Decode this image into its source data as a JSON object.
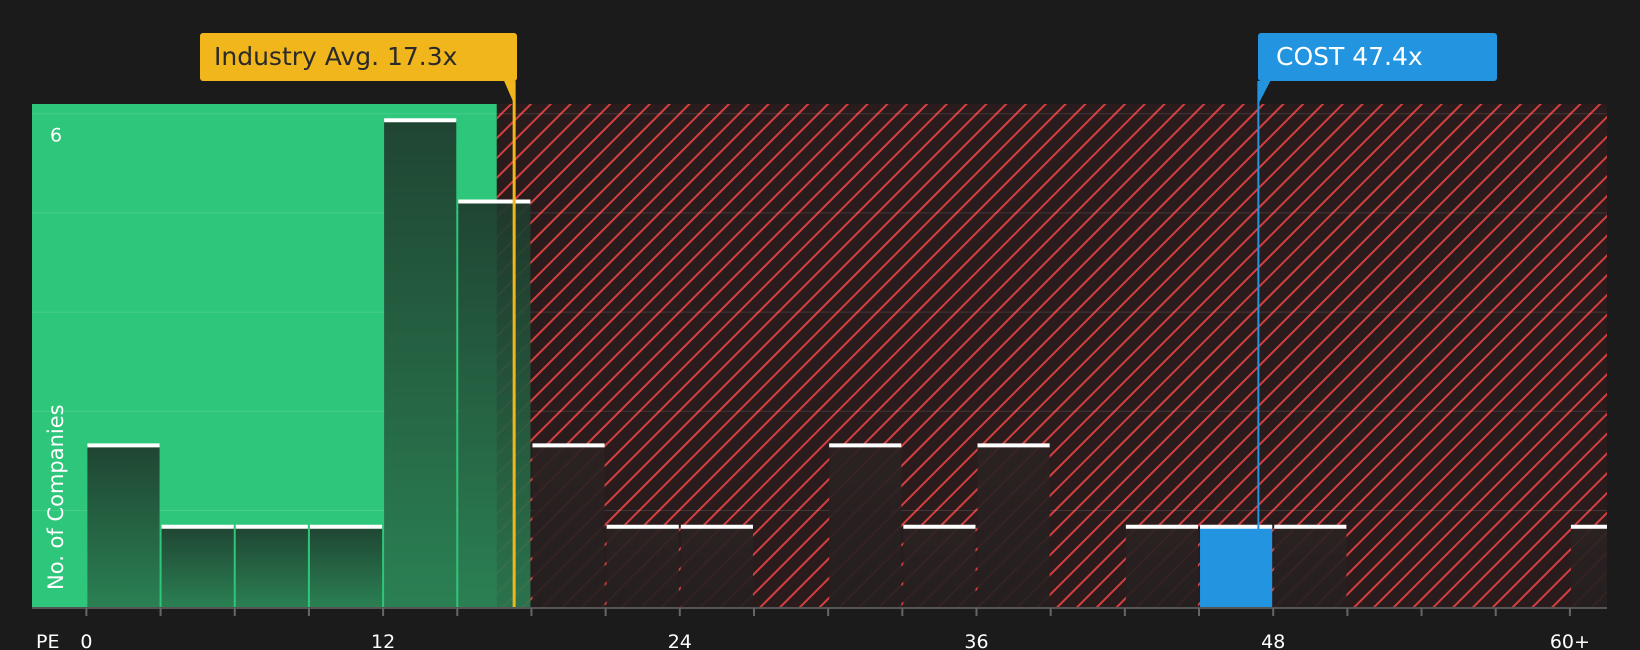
{
  "chart_data": {
    "type": "bar",
    "ylabel": "No. of Companies",
    "xaxis_label": "PE",
    "x_ticks": [
      {
        "value": 0,
        "label": "0"
      },
      {
        "value": 12,
        "label": "12"
      },
      {
        "value": 24,
        "label": "24"
      },
      {
        "value": 36,
        "label": "36"
      },
      {
        "value": 48,
        "label": "48"
      },
      {
        "value": 60,
        "label": "60+"
      }
    ],
    "y_ticks": [
      {
        "value": 6,
        "label": "6"
      }
    ],
    "ylim": [
      0,
      6.2
    ],
    "xlim": [
      -2.2,
      61.5
    ],
    "bin_width": 3,
    "bins": [
      {
        "x": 0,
        "count": 2
      },
      {
        "x": 3,
        "count": 1
      },
      {
        "x": 6,
        "count": 1
      },
      {
        "x": 9,
        "count": 1
      },
      {
        "x": 12,
        "count": 6
      },
      {
        "x": 15,
        "count": 5
      },
      {
        "x": 18,
        "count": 2
      },
      {
        "x": 21,
        "count": 1
      },
      {
        "x": 24,
        "count": 1
      },
      {
        "x": 27,
        "count": 0
      },
      {
        "x": 30,
        "count": 2
      },
      {
        "x": 33,
        "count": 1
      },
      {
        "x": 36,
        "count": 2
      },
      {
        "x": 39,
        "count": 0
      },
      {
        "x": 42,
        "count": 1
      },
      {
        "x": 45,
        "count": 1,
        "highlight": true
      },
      {
        "x": 48,
        "count": 1
      },
      {
        "x": 51,
        "count": 0
      },
      {
        "x": 54,
        "count": 0
      },
      {
        "x": 57,
        "count": 0
      },
      {
        "x": 60,
        "count": 1
      }
    ],
    "industry_avg": {
      "value": 17.3,
      "label": "Industry Avg. 17.3x"
    },
    "company": {
      "value": 47.4,
      "label": "COST 47.4x"
    },
    "fair_region_end": 16.6,
    "colors": {
      "background": "#1b1b1b",
      "fair_zone": "#2ec67a",
      "bar_dark": "#1f3d2e",
      "bar_dark_bottom": "#2b7a52",
      "expensive_hatch": "#d43f3f",
      "highlight_bar": "#2394e0",
      "industry_line": "#f0b61b",
      "company_line": "#2394e0",
      "cap": "#ffffff"
    }
  }
}
